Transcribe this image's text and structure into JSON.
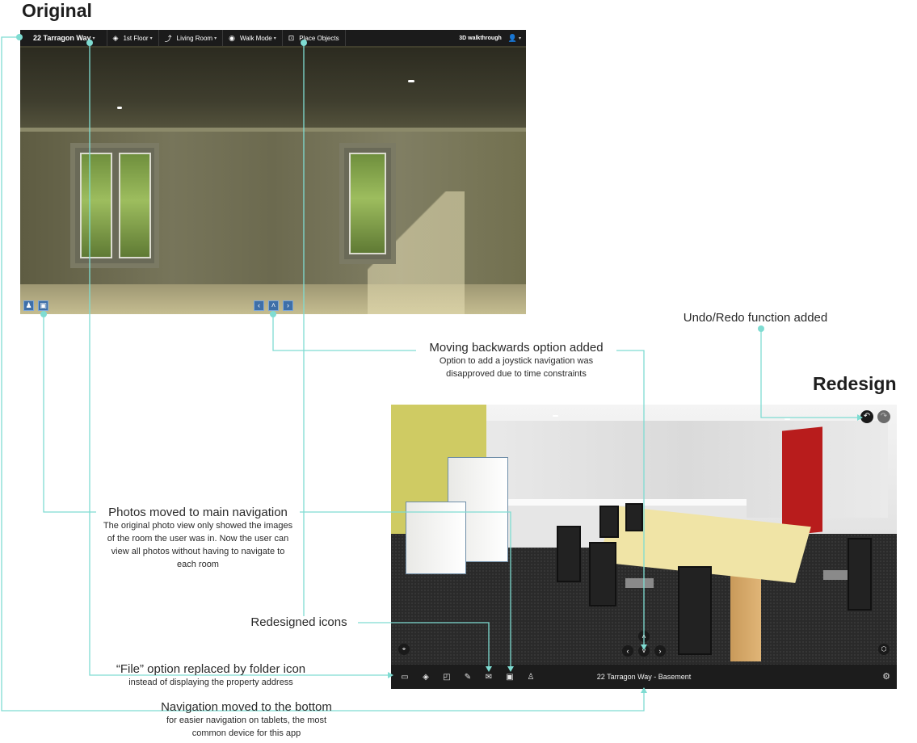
{
  "headings": {
    "original": "Original",
    "redesign": "Redesign"
  },
  "original_toolbar": {
    "property": "22 Tarragon Way",
    "floor": "1st Floor",
    "room": "Living Room",
    "mode": "Walk Mode",
    "place_objects": "Place Objects",
    "brand": "3D walkthrough"
  },
  "redesign_toolbar": {
    "location_title": "22 Tarragon Way - Basement"
  },
  "annotations": {
    "undo_redo": {
      "heading": "Undo/Redo function added"
    },
    "moving_backwards": {
      "heading": "Moving backwards option added",
      "sub": "Option to add a joystick navigation was disapproved due to time constraints"
    },
    "photos": {
      "heading": "Photos moved to main navigation",
      "sub": "The original photo view only showed the images of the room the user was in. Now the user can view all photos without having to navigate to each room"
    },
    "icons": {
      "heading": "Redesigned icons"
    },
    "file": {
      "heading": "“File” option replaced by folder icon",
      "sub": "instead of displaying the property address"
    },
    "nav_bottom": {
      "heading": "Navigation moved to the bottom",
      "sub": "for easier navigation on tablets, the most common device for this app"
    }
  },
  "icons": {
    "orig_layers": "layers-icon",
    "orig_stairs": "stairs-icon",
    "orig_eye": "eye-icon",
    "orig_place": "place-objects-icon",
    "orig_user": "user-icon",
    "orig_person": "person-icon",
    "orig_photo": "photo-icon",
    "redesign_bar": [
      "folder-icon",
      "layers-icon",
      "floorplan-icon",
      "tools-icon",
      "mail-icon",
      "photo-icon",
      "walk-icon"
    ]
  },
  "colors": {
    "accent_line": "#7fdcd2",
    "toolbar_bg": "#1b1b1b",
    "orig_button": "#3e6fa8"
  }
}
